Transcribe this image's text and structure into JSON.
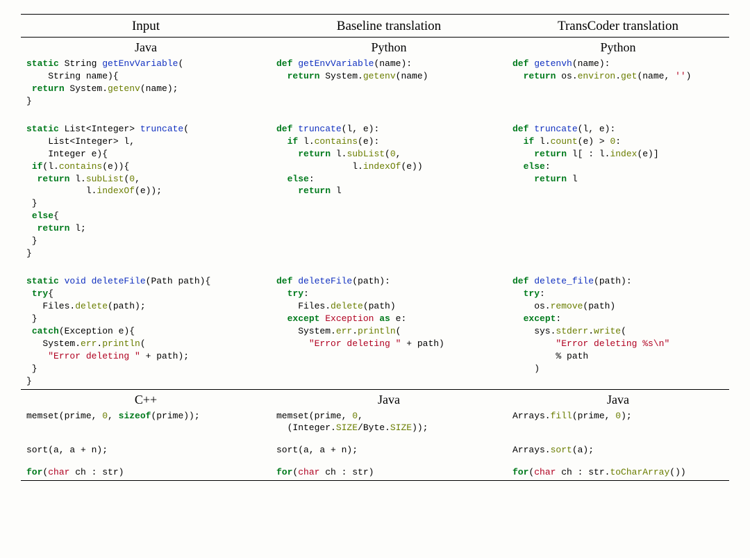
{
  "headers": {
    "c1": "Input",
    "c2": "Baseline translation",
    "c3": "TransCoder translation"
  },
  "section1": {
    "langs": {
      "c1": "Java",
      "c2": "Python",
      "c3": "Python"
    },
    "ex1": {
      "input": [
        {
          "t": "static ",
          "c": "kw"
        },
        {
          "t": "String "
        },
        {
          "t": "getEnvVariable",
          "c": "fn"
        },
        {
          "t": "(\n"
        },
        {
          "t": "    String name){\n"
        },
        {
          "t": " "
        },
        {
          "t": "return ",
          "c": "kw"
        },
        {
          "t": "System."
        },
        {
          "t": "getenv",
          "c": "mth"
        },
        {
          "t": "(name);\n"
        },
        {
          "t": "}"
        }
      ],
      "baseline": [
        {
          "t": "def ",
          "c": "kw"
        },
        {
          "t": "getEnvVariable",
          "c": "fn"
        },
        {
          "t": "(name):\n"
        },
        {
          "t": "  "
        },
        {
          "t": "return ",
          "c": "kw"
        },
        {
          "t": "System."
        },
        {
          "t": "getenv",
          "c": "mth"
        },
        {
          "t": "(name)"
        }
      ],
      "trans": [
        {
          "t": "def ",
          "c": "kw"
        },
        {
          "t": "getenvh",
          "c": "fn"
        },
        {
          "t": "(name):\n"
        },
        {
          "t": "  "
        },
        {
          "t": "return ",
          "c": "kw"
        },
        {
          "t": "os."
        },
        {
          "t": "environ",
          "c": "mth"
        },
        {
          "t": "."
        },
        {
          "t": "get",
          "c": "mth"
        },
        {
          "t": "(name, "
        },
        {
          "t": "''",
          "c": "str"
        },
        {
          "t": ")"
        }
      ]
    },
    "ex2": {
      "input": [
        {
          "t": "static ",
          "c": "kw"
        },
        {
          "t": "List<Integer> "
        },
        {
          "t": "truncate",
          "c": "fn"
        },
        {
          "t": "(\n"
        },
        {
          "t": "    List<Integer> l,\n"
        },
        {
          "t": "    Integer e){\n"
        },
        {
          "t": " "
        },
        {
          "t": "if",
          "c": "kw"
        },
        {
          "t": "(l."
        },
        {
          "t": "contains",
          "c": "mth"
        },
        {
          "t": "(e)){\n"
        },
        {
          "t": "  "
        },
        {
          "t": "return ",
          "c": "kw"
        },
        {
          "t": "l."
        },
        {
          "t": "subList",
          "c": "mth"
        },
        {
          "t": "("
        },
        {
          "t": "0",
          "c": "num"
        },
        {
          "t": ",\n"
        },
        {
          "t": "           l."
        },
        {
          "t": "indexOf",
          "c": "mth"
        },
        {
          "t": "(e));\n"
        },
        {
          "t": " }\n"
        },
        {
          "t": " "
        },
        {
          "t": "else",
          "c": "kw"
        },
        {
          "t": "{\n"
        },
        {
          "t": "  "
        },
        {
          "t": "return ",
          "c": "kw"
        },
        {
          "t": "l;\n"
        },
        {
          "t": " }\n"
        },
        {
          "t": "}"
        }
      ],
      "baseline": [
        {
          "t": "def ",
          "c": "kw"
        },
        {
          "t": "truncate",
          "c": "fn"
        },
        {
          "t": "(l, e):\n"
        },
        {
          "t": "  "
        },
        {
          "t": "if ",
          "c": "kw"
        },
        {
          "t": "l."
        },
        {
          "t": "contains",
          "c": "mth"
        },
        {
          "t": "(e):\n"
        },
        {
          "t": "    "
        },
        {
          "t": "return ",
          "c": "kw"
        },
        {
          "t": "l."
        },
        {
          "t": "subList",
          "c": "mth"
        },
        {
          "t": "("
        },
        {
          "t": "0",
          "c": "num"
        },
        {
          "t": ",\n"
        },
        {
          "t": "              l."
        },
        {
          "t": "indexOf",
          "c": "mth"
        },
        {
          "t": "(e))\n"
        },
        {
          "t": "  "
        },
        {
          "t": "else",
          "c": "kw"
        },
        {
          "t": ":\n"
        },
        {
          "t": "    "
        },
        {
          "t": "return ",
          "c": "kw"
        },
        {
          "t": "l"
        }
      ],
      "trans": [
        {
          "t": "def ",
          "c": "kw"
        },
        {
          "t": "truncate",
          "c": "fn"
        },
        {
          "t": "(l, e):\n"
        },
        {
          "t": "  "
        },
        {
          "t": "if ",
          "c": "kw"
        },
        {
          "t": "l."
        },
        {
          "t": "count",
          "c": "mth"
        },
        {
          "t": "(e) > "
        },
        {
          "t": "0",
          "c": "num"
        },
        {
          "t": ":\n"
        },
        {
          "t": "    "
        },
        {
          "t": "return ",
          "c": "kw"
        },
        {
          "t": "l[ : l."
        },
        {
          "t": "index",
          "c": "mth"
        },
        {
          "t": "(e)]\n"
        },
        {
          "t": "  "
        },
        {
          "t": "else",
          "c": "kw"
        },
        {
          "t": ":\n"
        },
        {
          "t": "    "
        },
        {
          "t": "return ",
          "c": "kw"
        },
        {
          "t": "l"
        }
      ]
    },
    "ex3": {
      "input": [
        {
          "t": "static ",
          "c": "kw"
        },
        {
          "t": "void ",
          "c": "fn"
        },
        {
          "t": "deleteFile",
          "c": "fn"
        },
        {
          "t": "(Path path){\n"
        },
        {
          "t": " "
        },
        {
          "t": "try",
          "c": "kw"
        },
        {
          "t": "{\n"
        },
        {
          "t": "   Files."
        },
        {
          "t": "delete",
          "c": "mth"
        },
        {
          "t": "(path);\n"
        },
        {
          "t": " }\n"
        },
        {
          "t": " "
        },
        {
          "t": "catch",
          "c": "kw"
        },
        {
          "t": "(Exception e){\n"
        },
        {
          "t": "   System."
        },
        {
          "t": "err",
          "c": "mth"
        },
        {
          "t": "."
        },
        {
          "t": "println",
          "c": "mth"
        },
        {
          "t": "(\n"
        },
        {
          "t": "    "
        },
        {
          "t": "\"Error deleting \"",
          "c": "str"
        },
        {
          "t": " + path);\n"
        },
        {
          "t": " }\n"
        },
        {
          "t": "}"
        }
      ],
      "baseline": [
        {
          "t": "def ",
          "c": "kw"
        },
        {
          "t": "deleteFile",
          "c": "fn"
        },
        {
          "t": "(path):\n"
        },
        {
          "t": "  "
        },
        {
          "t": "try",
          "c": "kw"
        },
        {
          "t": ":\n"
        },
        {
          "t": "    Files."
        },
        {
          "t": "delete",
          "c": "mth"
        },
        {
          "t": "(path)\n"
        },
        {
          "t": "  "
        },
        {
          "t": "except ",
          "c": "kw"
        },
        {
          "t": "Exception",
          "c": "err"
        },
        {
          "t": " "
        },
        {
          "t": "as ",
          "c": "kw"
        },
        {
          "t": "e:\n"
        },
        {
          "t": "    System."
        },
        {
          "t": "err",
          "c": "mth"
        },
        {
          "t": "."
        },
        {
          "t": "println",
          "c": "mth"
        },
        {
          "t": "(\n"
        },
        {
          "t": "      "
        },
        {
          "t": "\"Error deleting \"",
          "c": "str"
        },
        {
          "t": " + path)"
        }
      ],
      "trans": [
        {
          "t": "def ",
          "c": "kw"
        },
        {
          "t": "delete_file",
          "c": "fn"
        },
        {
          "t": "(path):\n"
        },
        {
          "t": "  "
        },
        {
          "t": "try",
          "c": "kw"
        },
        {
          "t": ":\n"
        },
        {
          "t": "    os."
        },
        {
          "t": "remove",
          "c": "mth"
        },
        {
          "t": "(path)\n"
        },
        {
          "t": "  "
        },
        {
          "t": "except",
          "c": "kw"
        },
        {
          "t": ":\n"
        },
        {
          "t": "    sys."
        },
        {
          "t": "stderr",
          "c": "mth"
        },
        {
          "t": "."
        },
        {
          "t": "write",
          "c": "mth"
        },
        {
          "t": "(\n"
        },
        {
          "t": "        "
        },
        {
          "t": "\"Error deleting %s\\n\"",
          "c": "str"
        },
        {
          "t": "\n"
        },
        {
          "t": "        % path\n"
        },
        {
          "t": "    )"
        }
      ]
    }
  },
  "section2": {
    "langs": {
      "c1": "C++",
      "c2": "Java",
      "c3": "Java"
    },
    "ex1": {
      "input": [
        {
          "t": "memset(prime, "
        },
        {
          "t": "0",
          "c": "num"
        },
        {
          "t": ", "
        },
        {
          "t": "sizeof",
          "c": "kw"
        },
        {
          "t": "(prime));"
        }
      ],
      "baseline": [
        {
          "t": "memset(prime, "
        },
        {
          "t": "0",
          "c": "num"
        },
        {
          "t": ",\n"
        },
        {
          "t": "  (Integer."
        },
        {
          "t": "SIZE",
          "c": "mth"
        },
        {
          "t": "/Byte."
        },
        {
          "t": "SIZE",
          "c": "mth"
        },
        {
          "t": "));"
        }
      ],
      "trans": [
        {
          "t": "Arrays."
        },
        {
          "t": "fill",
          "c": "mth"
        },
        {
          "t": "(prime, "
        },
        {
          "t": "0",
          "c": "num"
        },
        {
          "t": ");"
        }
      ]
    },
    "ex2": {
      "input": [
        {
          "t": "sort(a, a + n);"
        }
      ],
      "baseline": [
        {
          "t": "sort(a, a + n);"
        }
      ],
      "trans": [
        {
          "t": "Arrays."
        },
        {
          "t": "sort",
          "c": "mth"
        },
        {
          "t": "(a);"
        }
      ]
    },
    "ex3": {
      "input": [
        {
          "t": "for",
          "c": "kw"
        },
        {
          "t": "("
        },
        {
          "t": "char ",
          "c": "err"
        },
        {
          "t": "ch : str)"
        }
      ],
      "baseline": [
        {
          "t": "for",
          "c": "kw"
        },
        {
          "t": "("
        },
        {
          "t": "char ",
          "c": "err"
        },
        {
          "t": "ch : str)"
        }
      ],
      "trans": [
        {
          "t": "for",
          "c": "kw"
        },
        {
          "t": "("
        },
        {
          "t": "char ",
          "c": "err"
        },
        {
          "t": "ch : str."
        },
        {
          "t": "toCharArray",
          "c": "mth"
        },
        {
          "t": "())"
        }
      ]
    }
  }
}
